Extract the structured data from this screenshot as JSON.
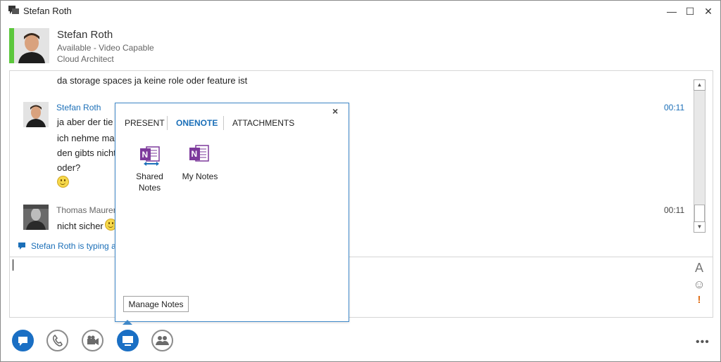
{
  "window": {
    "title": "Stefan Roth",
    "minimize": "—",
    "maximize": "☐",
    "close": "✕"
  },
  "contact": {
    "name": "Stefan Roth",
    "status": "Available - Video Capable",
    "job_title": "Cloud Architect",
    "status_color": "#5cc73c"
  },
  "conversation": {
    "prev_line": "da storage spaces ja keine role oder feature ist",
    "messages": [
      {
        "sender": "Stefan Roth",
        "time": "00:11",
        "lines": [
          "ja aber der tie",
          "ich nehme mal",
          "den gibts nicht",
          "oder?"
        ],
        "emoji": "smiley"
      },
      {
        "sender": "Thomas Maurer",
        "time": "00:11",
        "lines": [
          "nicht sicher"
        ],
        "emoji": "smiley"
      }
    ],
    "typing_indicator": "Stefan Roth is typing a"
  },
  "popup": {
    "tabs": [
      "PRESENT",
      "ONENOTE",
      "ATTACHMENTS"
    ],
    "active_tab": "ONENOTE",
    "items": [
      {
        "label_line1": "Shared",
        "label_line2": "Notes",
        "icon": "onenote-shared-icon"
      },
      {
        "label_line1": "My Notes",
        "label_line2": "",
        "icon": "onenote-icon"
      }
    ],
    "manage_button": "Manage Notes",
    "close": "×"
  },
  "input": {
    "font_icon": "A",
    "emoticon_icon": "☺",
    "importance_icon": "!"
  },
  "toolbar": {
    "more": "•••",
    "accent": "#1a6fc4"
  },
  "colors": {
    "link_blue": "#1b6fb8",
    "onenote_purple": "#7d3a9c"
  }
}
